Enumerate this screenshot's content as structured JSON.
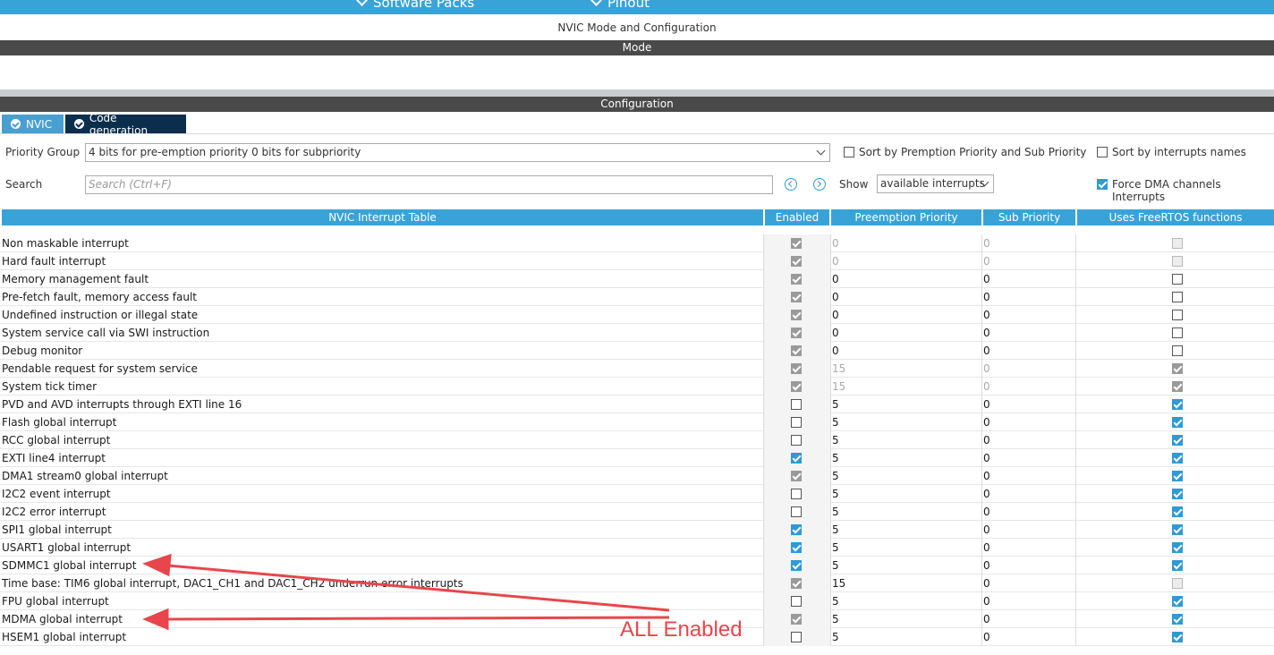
{
  "nav": {
    "software_packs": "Software Packs",
    "pinout": "Pinout"
  },
  "window_title": "NVIC Mode and Configuration",
  "mode_label": "Mode",
  "configuration_label": "Configuration",
  "tabs": [
    {
      "label": "NVIC"
    },
    {
      "label": "Code generation"
    }
  ],
  "controls": {
    "priority_group_label": "Priority Group",
    "priority_group_value": "4 bits for pre-emption priority 0 bits for subpriority",
    "sort_premption_label": "Sort by Premption Priority and Sub Priority",
    "sort_premption_checked": false,
    "sort_names_label": "Sort by interrupts names",
    "sort_names_checked": false,
    "search_label": "Search",
    "search_placeholder": "Search (Ctrl+F)",
    "show_label": "Show",
    "show_value": "available interrupts",
    "force_dma_label": "Force DMA channels Interrupts",
    "force_dma_checked": true
  },
  "table": {
    "headers": {
      "name": "NVIC Interrupt Table",
      "enabled": "Enabled",
      "preemption": "Preemption Priority",
      "sub": "Sub Priority",
      "freertos": "Uses FreeRTOS functions"
    },
    "rows": [
      {
        "name": "Non maskable interrupt",
        "enabled": true,
        "enabled_disabled": true,
        "preemption": "0",
        "sub": "0",
        "prio_disabled": true,
        "freertos": false,
        "freertos_disabled": true
      },
      {
        "name": "Hard fault interrupt",
        "enabled": true,
        "enabled_disabled": true,
        "preemption": "0",
        "sub": "0",
        "prio_disabled": true,
        "freertos": false,
        "freertos_disabled": true
      },
      {
        "name": "Memory management fault",
        "enabled": true,
        "enabled_disabled": true,
        "preemption": "0",
        "sub": "0",
        "prio_disabled": false,
        "freertos": false,
        "freertos_disabled": false
      },
      {
        "name": "Pre-fetch fault, memory access fault",
        "enabled": true,
        "enabled_disabled": true,
        "preemption": "0",
        "sub": "0",
        "prio_disabled": false,
        "freertos": false,
        "freertos_disabled": false
      },
      {
        "name": "Undefined instruction or illegal state",
        "enabled": true,
        "enabled_disabled": true,
        "preemption": "0",
        "sub": "0",
        "prio_disabled": false,
        "freertos": false,
        "freertos_disabled": false
      },
      {
        "name": "System service call via SWI instruction",
        "enabled": true,
        "enabled_disabled": true,
        "preemption": "0",
        "sub": "0",
        "prio_disabled": false,
        "freertos": false,
        "freertos_disabled": false
      },
      {
        "name": "Debug monitor",
        "enabled": true,
        "enabled_disabled": true,
        "preemption": "0",
        "sub": "0",
        "prio_disabled": false,
        "freertos": false,
        "freertos_disabled": false
      },
      {
        "name": "Pendable request for system service",
        "enabled": true,
        "enabled_disabled": true,
        "preemption": "15",
        "sub": "0",
        "prio_disabled": true,
        "freertos": true,
        "freertos_disabled": true
      },
      {
        "name": "System tick timer",
        "enabled": true,
        "enabled_disabled": true,
        "preemption": "15",
        "sub": "0",
        "prio_disabled": true,
        "freertos": true,
        "freertos_disabled": true
      },
      {
        "name": "PVD and AVD interrupts through EXTI line 16",
        "enabled": false,
        "enabled_disabled": false,
        "preemption": "5",
        "sub": "0",
        "prio_disabled": false,
        "freertos": true,
        "freertos_disabled": false
      },
      {
        "name": "Flash global interrupt",
        "enabled": false,
        "enabled_disabled": false,
        "preemption": "5",
        "sub": "0",
        "prio_disabled": false,
        "freertos": true,
        "freertos_disabled": false
      },
      {
        "name": "RCC global interrupt",
        "enabled": false,
        "enabled_disabled": false,
        "preemption": "5",
        "sub": "0",
        "prio_disabled": false,
        "freertos": true,
        "freertos_disabled": false
      },
      {
        "name": "EXTI line4 interrupt",
        "enabled": true,
        "enabled_disabled": false,
        "preemption": "5",
        "sub": "0",
        "prio_disabled": false,
        "freertos": true,
        "freertos_disabled": false
      },
      {
        "name": "DMA1 stream0 global interrupt",
        "enabled": true,
        "enabled_disabled": true,
        "preemption": "5",
        "sub": "0",
        "prio_disabled": false,
        "freertos": true,
        "freertos_disabled": false
      },
      {
        "name": "I2C2 event interrupt",
        "enabled": false,
        "enabled_disabled": false,
        "preemption": "5",
        "sub": "0",
        "prio_disabled": false,
        "freertos": true,
        "freertos_disabled": false
      },
      {
        "name": "I2C2 error interrupt",
        "enabled": false,
        "enabled_disabled": false,
        "preemption": "5",
        "sub": "0",
        "prio_disabled": false,
        "freertos": true,
        "freertos_disabled": false
      },
      {
        "name": "SPI1 global interrupt",
        "enabled": true,
        "enabled_disabled": false,
        "preemption": "5",
        "sub": "0",
        "prio_disabled": false,
        "freertos": true,
        "freertos_disabled": false
      },
      {
        "name": "USART1 global interrupt",
        "enabled": true,
        "enabled_disabled": false,
        "preemption": "5",
        "sub": "0",
        "prio_disabled": false,
        "freertos": true,
        "freertos_disabled": false
      },
      {
        "name": "SDMMC1 global interrupt",
        "enabled": true,
        "enabled_disabled": false,
        "preemption": "5",
        "sub": "0",
        "prio_disabled": false,
        "freertos": true,
        "freertos_disabled": false
      },
      {
        "name": "Time base: TIM6 global interrupt, DAC1_CH1 and DAC1_CH2 underrun error interrupts",
        "enabled": true,
        "enabled_disabled": true,
        "preemption": "15",
        "sub": "0",
        "prio_disabled": false,
        "freertos": false,
        "freertos_disabled": true
      },
      {
        "name": "FPU global interrupt",
        "enabled": false,
        "enabled_disabled": false,
        "preemption": "5",
        "sub": "0",
        "prio_disabled": false,
        "freertos": true,
        "freertos_disabled": false
      },
      {
        "name": "MDMA global interrupt",
        "enabled": true,
        "enabled_disabled": true,
        "preemption": "5",
        "sub": "0",
        "prio_disabled": false,
        "freertos": true,
        "freertos_disabled": false
      },
      {
        "name": "HSEM1 global interrupt",
        "enabled": false,
        "enabled_disabled": false,
        "preemption": "5",
        "sub": "0",
        "prio_disabled": false,
        "freertos": true,
        "freertos_disabled": false
      }
    ]
  },
  "annotation": {
    "text": "ALL Enabled",
    "color": "#e8464c"
  },
  "colors": {
    "accent": "#39a3d8",
    "check": "#2e9ad6",
    "dark_bar": "#4a4a4a",
    "code_gen_tab": "#0c2e4d"
  }
}
